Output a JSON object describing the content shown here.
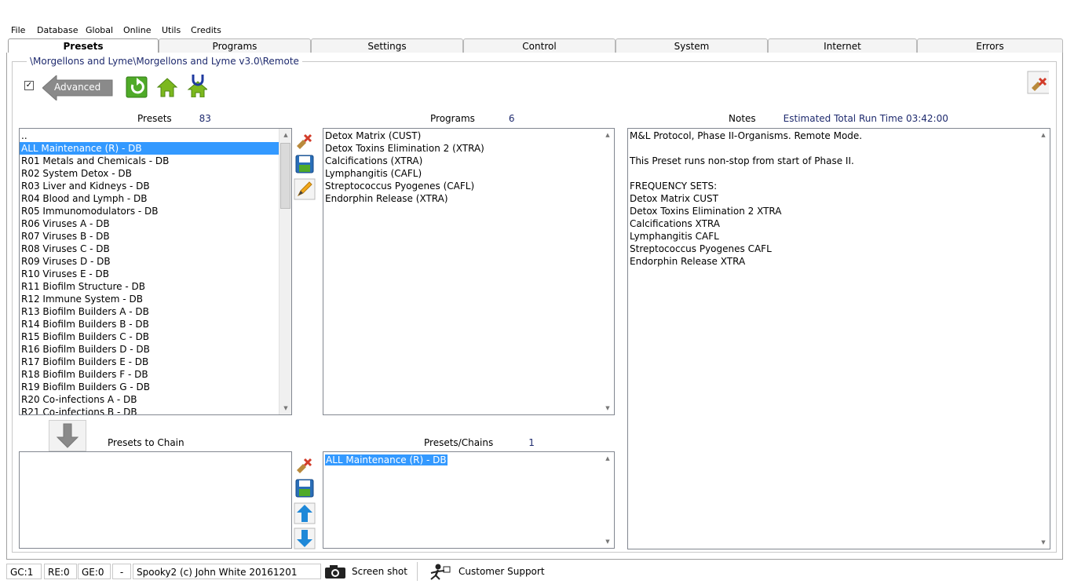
{
  "menu": {
    "items": [
      "File",
      "Database",
      "Global",
      "Online",
      "Utils",
      "Credits"
    ]
  },
  "tabs": [
    "Presets",
    "Programs",
    "Settings",
    "Control",
    "System",
    "Internet",
    "Errors"
  ],
  "active_tab": "Presets",
  "path": "\\Morgellons and Lyme\\Morgellons and Lyme v3.0\\Remote",
  "advanced": {
    "checked": true,
    "label": "Advanced"
  },
  "presets": {
    "header": "Presets",
    "count": "83",
    "items": [
      "..",
      "ALL Maintenance (R) - DB",
      "R01 Metals and Chemicals - DB",
      "R02 System Detox - DB",
      "R03 Liver and Kidneys - DB",
      "R04 Blood and Lymph - DB",
      "R05 Immunomodulators - DB",
      "R06 Viruses A - DB",
      "R07 Viruses B - DB",
      "R08 Viruses C - DB",
      "R09 Viruses D - DB",
      "R10 Viruses E - DB",
      "R11 Biofilm Structure - DB",
      "R12 Immune System - DB",
      "R13 Biofilm Builders A - DB",
      "R14 Biofilm Builders B - DB",
      "R15 Biofilm Builders C - DB",
      "R16 Biofilm Builders D - DB",
      "R17 Biofilm Builders E - DB",
      "R18 Biofilm Builders F - DB",
      "R19 Biofilm Builders G - DB",
      "R20 Co-infections A - DB",
      "R21 Co-infections B - DB"
    ],
    "selected_index": 1
  },
  "programs": {
    "header": "Programs",
    "count": "6",
    "items": [
      "Detox Matrix (CUST)",
      "Detox Toxins Elimination 2 (XTRA)",
      "Calcifications (XTRA)",
      "Lymphangitis (CAFL)",
      "Streptococcus Pyogenes (CAFL)",
      "Endorphin Release (XTRA)"
    ]
  },
  "notes": {
    "header": "Notes",
    "run_time": "Estimated Total Run Time 03:42:00",
    "lines": [
      "M&L Protocol, Phase II-Organisms. Remote Mode.",
      "",
      "This Preset runs non-stop from start of Phase II.",
      "",
      "FREQUENCY SETS:",
      "Detox Matrix CUST",
      "Detox Toxins Elimination 2 XTRA",
      "Calcifications XTRA",
      "Lymphangitis CAFL",
      "Streptococcus Pyogenes CAFL",
      "Endorphin Release XTRA"
    ]
  },
  "chain": {
    "header": "Presets to Chain",
    "chains_header": "Presets/Chains",
    "chains_count": "1",
    "chains_items": [
      "ALL Maintenance (R) - DB"
    ]
  },
  "status": {
    "gc": "GC:1",
    "re": "RE:0",
    "ge": "GE:0",
    "dash": "-",
    "copyright": "Spooky2 (c) John White 20161201",
    "screenshot": "Screen shot",
    "support": "Customer Support"
  },
  "colors": {
    "selection": "#3399ff",
    "accent_text": "#1e2a6e",
    "icon_green": "#6aa830",
    "icon_red": "#d23c2a"
  }
}
